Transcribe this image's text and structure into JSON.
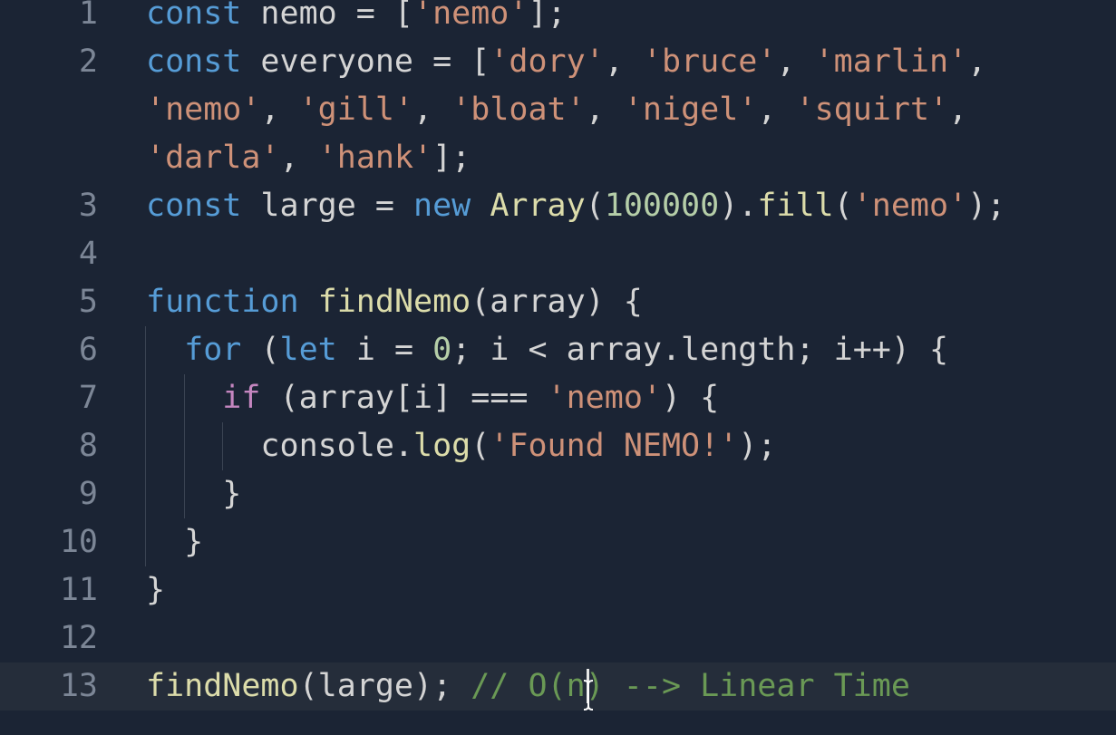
{
  "editor": {
    "active_line": "13",
    "lines": [
      {
        "number": "1",
        "rows": [
          [
            {
              "t": "const",
              "c": "kw"
            },
            {
              "t": " nemo = [",
              "c": "pl"
            },
            {
              "t": "'nemo'",
              "c": "str"
            },
            {
              "t": "];",
              "c": "pl"
            }
          ]
        ]
      },
      {
        "number": "2",
        "rows": [
          [
            {
              "t": "const",
              "c": "kw"
            },
            {
              "t": " everyone = [",
              "c": "pl"
            },
            {
              "t": "'dory'",
              "c": "str"
            },
            {
              "t": ", ",
              "c": "pl"
            },
            {
              "t": "'bruce'",
              "c": "str"
            },
            {
              "t": ", ",
              "c": "pl"
            },
            {
              "t": "'marlin'",
              "c": "str"
            },
            {
              "t": ",",
              "c": "pl"
            }
          ],
          [
            {
              "t": "'nemo'",
              "c": "str"
            },
            {
              "t": ", ",
              "c": "pl"
            },
            {
              "t": "'gill'",
              "c": "str"
            },
            {
              "t": ", ",
              "c": "pl"
            },
            {
              "t": "'bloat'",
              "c": "str"
            },
            {
              "t": ", ",
              "c": "pl"
            },
            {
              "t": "'nigel'",
              "c": "str"
            },
            {
              "t": ", ",
              "c": "pl"
            },
            {
              "t": "'squirt'",
              "c": "str"
            },
            {
              "t": ",",
              "c": "pl"
            }
          ],
          [
            {
              "t": "'darla'",
              "c": "str"
            },
            {
              "t": ", ",
              "c": "pl"
            },
            {
              "t": "'hank'",
              "c": "str"
            },
            {
              "t": "];",
              "c": "pl"
            }
          ]
        ]
      },
      {
        "number": "3",
        "rows": [
          [
            {
              "t": "const",
              "c": "kw"
            },
            {
              "t": " large = ",
              "c": "pl"
            },
            {
              "t": "new",
              "c": "kw"
            },
            {
              "t": " ",
              "c": "pl"
            },
            {
              "t": "Array",
              "c": "fn"
            },
            {
              "t": "(",
              "c": "pl"
            },
            {
              "t": "100000",
              "c": "num"
            },
            {
              "t": ").",
              "c": "pl"
            },
            {
              "t": "fill",
              "c": "fn"
            },
            {
              "t": "(",
              "c": "pl"
            },
            {
              "t": "'nemo'",
              "c": "str"
            },
            {
              "t": ");",
              "c": "pl"
            }
          ]
        ]
      },
      {
        "number": "4",
        "rows": [
          []
        ]
      },
      {
        "number": "5",
        "rows": [
          [
            {
              "t": "function",
              "c": "kw"
            },
            {
              "t": " ",
              "c": "pl"
            },
            {
              "t": "findNemo",
              "c": "fn"
            },
            {
              "t": "(array) {",
              "c": "pl"
            }
          ]
        ]
      },
      {
        "number": "6",
        "rows": [
          [
            {
              "t": "  ",
              "c": "pl"
            },
            {
              "t": "for",
              "c": "kw"
            },
            {
              "t": " (",
              "c": "pl"
            },
            {
              "t": "let",
              "c": "kw"
            },
            {
              "t": " i = ",
              "c": "pl"
            },
            {
              "t": "0",
              "c": "num"
            },
            {
              "t": "; i < array.length; i++) {",
              "c": "pl"
            }
          ]
        ]
      },
      {
        "number": "7",
        "rows": [
          [
            {
              "t": "    ",
              "c": "pl"
            },
            {
              "t": "if",
              "c": "ctrl"
            },
            {
              "t": " (array[i] === ",
              "c": "pl"
            },
            {
              "t": "'nemo'",
              "c": "str"
            },
            {
              "t": ") {",
              "c": "pl"
            }
          ]
        ]
      },
      {
        "number": "8",
        "rows": [
          [
            {
              "t": "      console.",
              "c": "pl"
            },
            {
              "t": "log",
              "c": "fn"
            },
            {
              "t": "(",
              "c": "pl"
            },
            {
              "t": "'Found NEMO!'",
              "c": "str"
            },
            {
              "t": ");",
              "c": "pl"
            }
          ]
        ]
      },
      {
        "number": "9",
        "rows": [
          [
            {
              "t": "    }",
              "c": "pl"
            }
          ]
        ]
      },
      {
        "number": "10",
        "rows": [
          [
            {
              "t": "  }",
              "c": "pl"
            }
          ]
        ]
      },
      {
        "number": "11",
        "rows": [
          [
            {
              "t": "}",
              "c": "pl"
            }
          ]
        ]
      },
      {
        "number": "12",
        "rows": [
          []
        ]
      },
      {
        "number": "13",
        "rows": [
          [
            {
              "t": "findNemo",
              "c": "fn"
            },
            {
              "t": "(large); ",
              "c": "pl"
            },
            {
              "t": "// O(n) --> Linear Time",
              "c": "cm"
            }
          ]
        ]
      }
    ]
  }
}
